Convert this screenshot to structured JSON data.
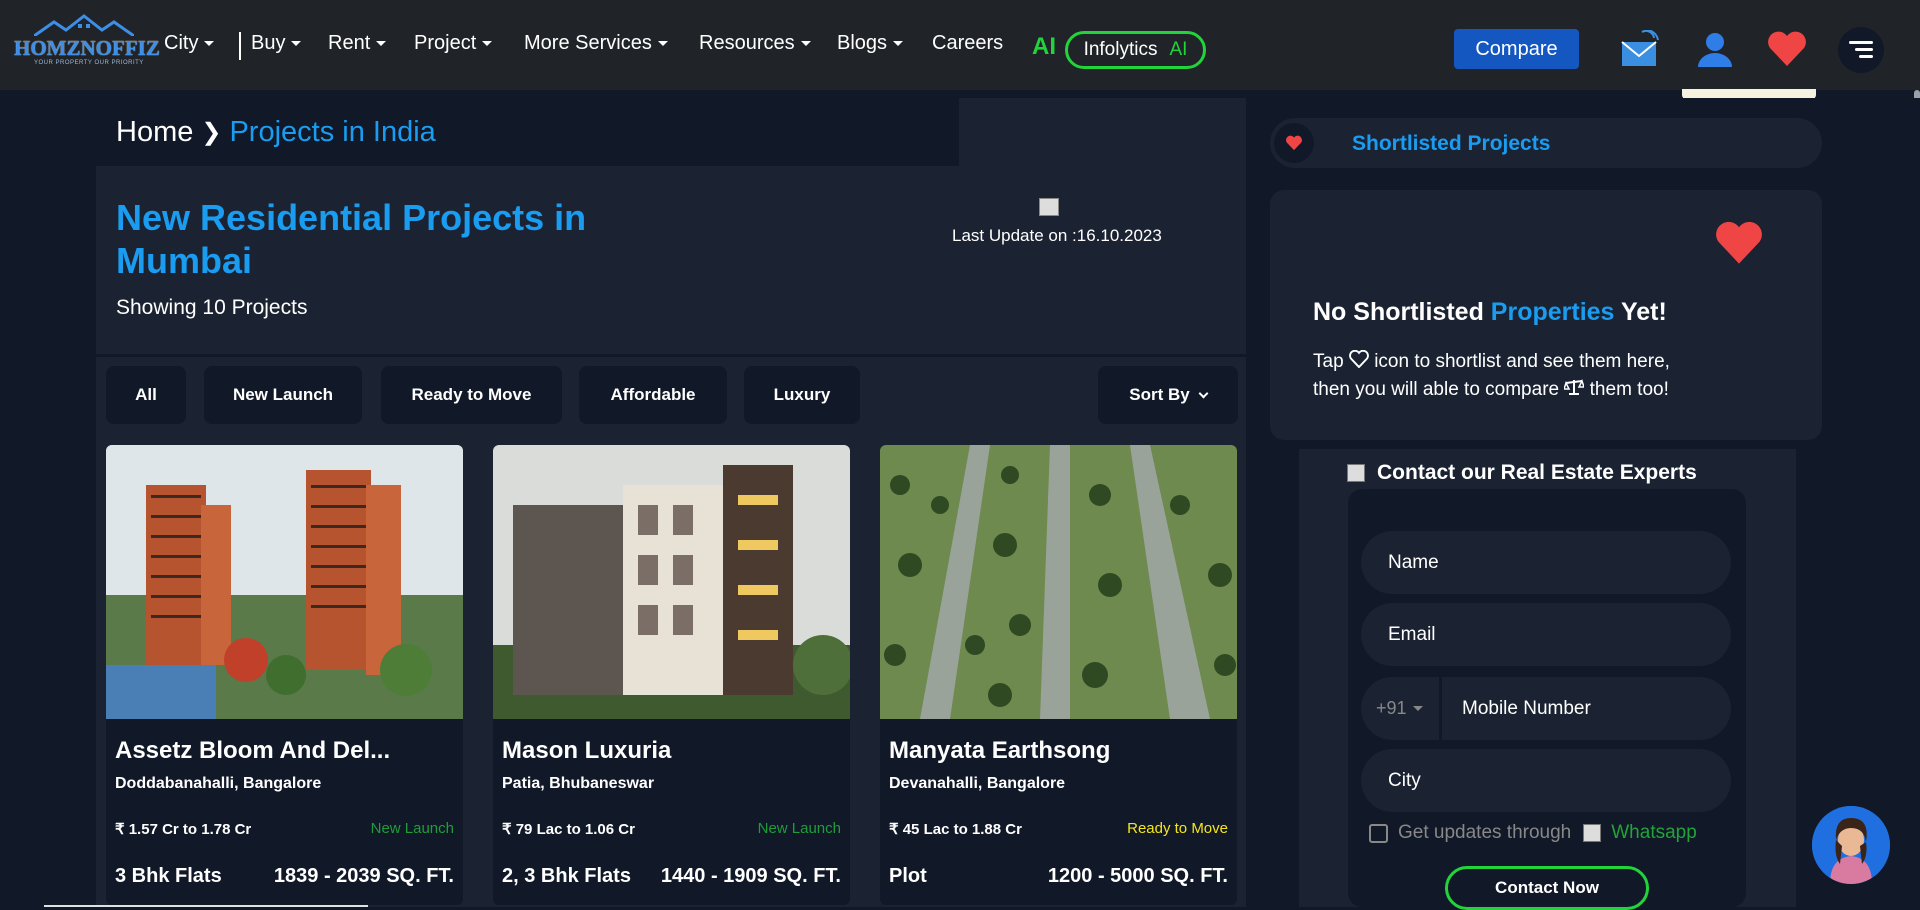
{
  "nav": {
    "logo_text": "HOMZNOFFIZ",
    "logo_tagline": "YOUR PROPERTY OUR PRIORITY",
    "items": [
      "City",
      "Buy",
      "Rent",
      "Project",
      "More Services",
      "Resources",
      "Blogs",
      "Careers"
    ],
    "ai_label": "AI",
    "infolytics": "Infolytics",
    "infolytics_ai": "AI",
    "compare": "Compare",
    "icons": [
      "mail-icon",
      "user-icon",
      "heart-icon",
      "menu-icon"
    ]
  },
  "breadcrumb": {
    "home": "Home",
    "separator": "❯",
    "current": "Projects in India"
  },
  "header": {
    "title": "New Residential Projects in Mumbai",
    "showing": "Showing 10 Projects",
    "last_update": "Last Update on :16.10.2023"
  },
  "filters": [
    "All",
    "New Launch",
    "Ready to Move",
    "Affordable",
    "Luxury"
  ],
  "sort_label": "Sort By",
  "cards": [
    {
      "name": "Assetz Bloom And Del...",
      "location": "Doddabanahalli, Bangalore",
      "price": "₹ 1.57 Cr to 1.78 Cr",
      "status": "New Launch",
      "status_color": "#1f9d3a",
      "type": "3 Bhk Flats",
      "area": "1839 - 2039 SQ. FT."
    },
    {
      "name": "Mason Luxuria",
      "location": "Patia, Bhubaneswar",
      "price": "₹ 79 Lac to 1.06 Cr",
      "status": "New Launch",
      "status_color": "#1f9d3a",
      "type": "2, 3 Bhk Flats",
      "area": "1440 - 1909 SQ. FT."
    },
    {
      "name": "Manyata Earthsong",
      "location": "Devanahalli, Bangalore",
      "price": "₹ 45 Lac to 1.88 Cr",
      "status": "Ready to Move",
      "status_color": "#f5e51c",
      "type": "Plot",
      "area": "1200 - 5000 SQ. FT."
    }
  ],
  "shortlist": {
    "title": "Shortlisted Projects",
    "empty_heading_pre": "No Shortlisted",
    "empty_heading_blue": "Properties",
    "empty_heading_post": "Yet!",
    "empty_line1_pre": "Tap",
    "empty_line1_post": "icon to shortlist and see them here,",
    "empty_line2_pre": "then you will able to compare",
    "empty_line2_post": "them too!"
  },
  "contact": {
    "title": "Contact our Real Estate Experts",
    "name_placeholder": "Name",
    "email_placeholder": "Email",
    "country_code": "+91",
    "mobile_placeholder": "Mobile Number",
    "city_placeholder": "City",
    "updates_text": "Get updates through",
    "whatsapp": "Whatsapp",
    "submit": "Contact Now"
  },
  "colors": {
    "accent_blue": "#1a9cf1",
    "green": "#22d33a",
    "bg": "#111827",
    "panel": "#1b2333"
  }
}
